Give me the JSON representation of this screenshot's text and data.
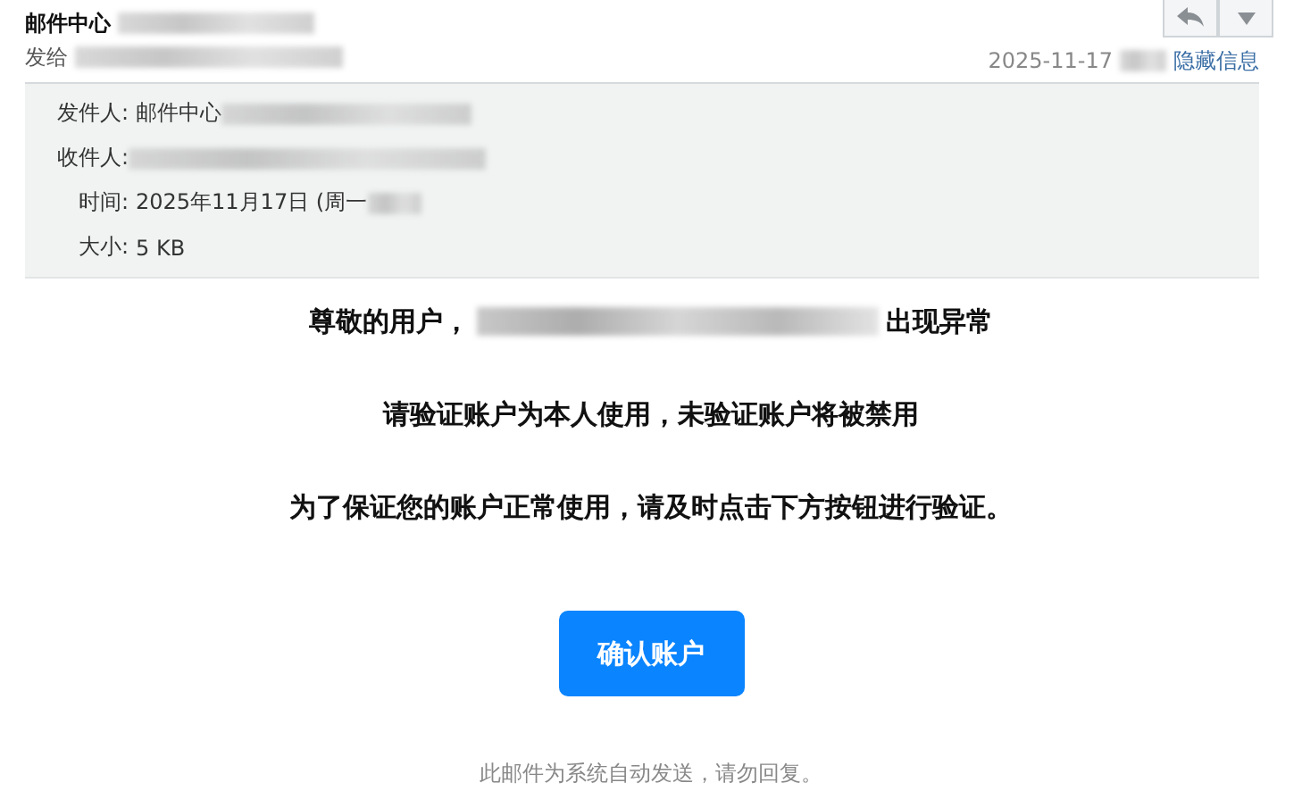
{
  "header": {
    "sender": "邮件中心",
    "to_label": "发给",
    "date": "2025-11-17",
    "toggle_link": "隐藏信息"
  },
  "details": [
    {
      "label": "发件人:",
      "value": "邮件中心",
      "redacted": true
    },
    {
      "label": "收件人:",
      "redacted": true
    },
    {
      "label": "时间:",
      "value": "2025年11月17日 (周一",
      "redacted": true
    },
    {
      "label": "大小:",
      "value": "5 KB",
      "redacted": false
    }
  ],
  "body": {
    "greeting": "尊敬的用户，",
    "greeting_end": "出现异常",
    "lines": [
      "请验证账户为本人使用，未验证账户将被禁用",
      "为了保证您的账户正常使用，请及时点击下方按钮进行验证。"
    ],
    "button": "确认账户",
    "footer": "此邮件为系统自动发送，请勿回复。"
  }
}
